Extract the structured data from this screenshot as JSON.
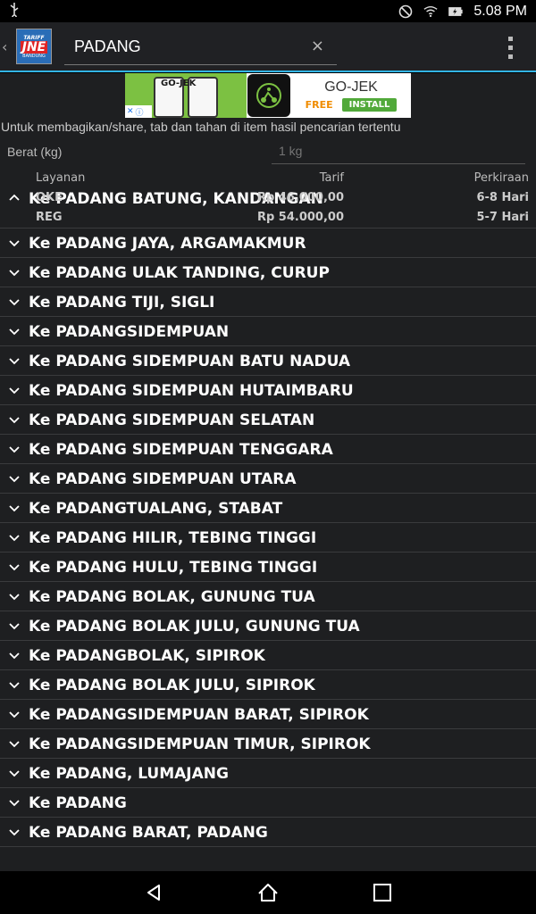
{
  "status_bar": {
    "time": "5.08 PM"
  },
  "app": {
    "logo_lines": [
      "TARIFF",
      "JNE",
      "BANDUNG"
    ],
    "search": {
      "value": "PADANG",
      "clear_glyph": "×"
    }
  },
  "ad": {
    "title": "GO-JEK",
    "phone_text": "GO-JEK",
    "free_label": "FREE",
    "install_label": "INSTALL"
  },
  "hint_text": "Untuk membagikan/share, tab dan tahan di item hasil pencarian tertentu",
  "weight": {
    "label": "Berat (kg)",
    "placeholder": "1 kg"
  },
  "results": {
    "expanded": {
      "title": "Ke PADANG BATUNG, KANDANGAN",
      "headers": [
        "Layanan",
        "Tarif",
        "Perkiraan"
      ],
      "rows": [
        [
          "OKE",
          "Rp 46.000,00",
          "6-8 Hari"
        ],
        [
          "REG",
          "Rp 54.000,00",
          "5-7 Hari"
        ]
      ]
    },
    "items": [
      "Ke PADANG JAYA, ARGAMAKMUR",
      "Ke PADANG ULAK TANDING, CURUP",
      "Ke PADANG TIJI, SIGLI",
      "Ke PADANGSIDEMPUAN",
      "Ke PADANG SIDEMPUAN BATU NADUA",
      "Ke PADANG SIDEMPUAN HUTAIMBARU",
      "Ke PADANG SIDEMPUAN SELATAN",
      "Ke PADANG SIDEMPUAN TENGGARA",
      "Ke PADANG SIDEMPUAN UTARA",
      "Ke PADANGTUALANG, STABAT",
      "Ke PADANG HILIR, TEBING TINGGI",
      "Ke PADANG HULU, TEBING TINGGI",
      "Ke PADANG BOLAK, GUNUNG TUA",
      "Ke PADANG BOLAK JULU, GUNUNG TUA",
      "Ke PADANGBOLAK, SIPIROK",
      "Ke PADANG BOLAK JULU, SIPIROK",
      "Ke PADANGSIDEMPUAN BARAT, SIPIROK",
      "Ke PADANGSIDEMPUAN TIMUR, SIPIROK",
      "Ke PADANG, LUMAJANG",
      "Ke PADANG",
      "Ke PADANG BARAT, PADANG"
    ]
  },
  "colors": {
    "accent": "#33b5e5",
    "background": "#1e1f21",
    "ad_green": "#7cc142"
  }
}
